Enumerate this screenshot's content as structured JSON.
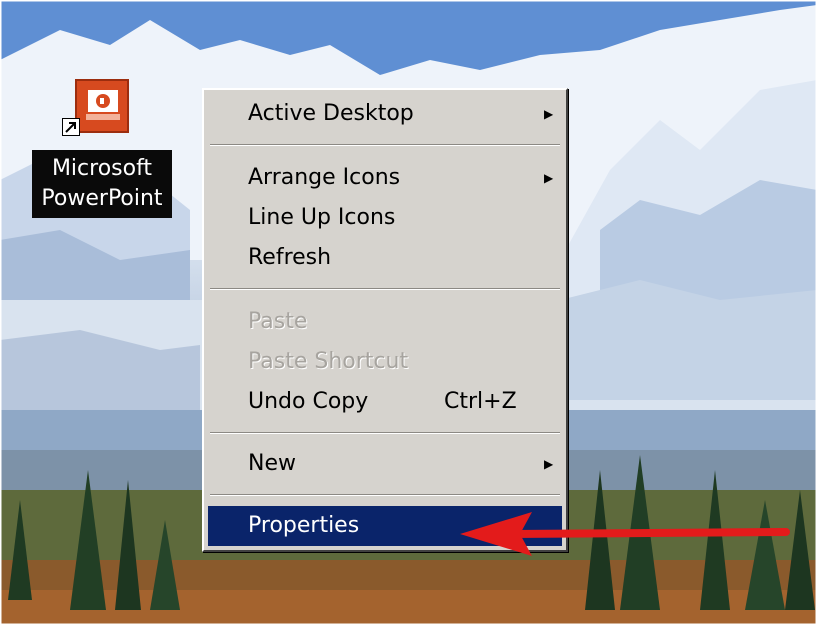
{
  "desktop": {
    "icon": {
      "label_line1": "Microsoft",
      "label_line2": "PowerPoint",
      "icon_name": "powerpoint-icon",
      "shortcut_overlay": "shortcut-arrow-icon"
    }
  },
  "context_menu": {
    "items": [
      {
        "label": "Active Desktop",
        "submenu": true
      },
      {
        "label": "Arrange Icons",
        "submenu": true
      },
      {
        "label": "Line Up Icons"
      },
      {
        "label": "Refresh"
      },
      {
        "label": "Paste",
        "disabled": true
      },
      {
        "label": "Paste Shortcut",
        "disabled": true
      },
      {
        "label": "Undo Copy",
        "shortcut": "Ctrl+Z"
      },
      {
        "label": "New",
        "submenu": true
      },
      {
        "label": "Properties",
        "selected": true
      }
    ],
    "colors": {
      "menu_bg": "#d6d3ce",
      "highlight": "#0a246a",
      "disabled_text": "#a7a49f"
    }
  },
  "annotation": {
    "arrow_color": "#e31b1b",
    "points_to": "Properties"
  }
}
